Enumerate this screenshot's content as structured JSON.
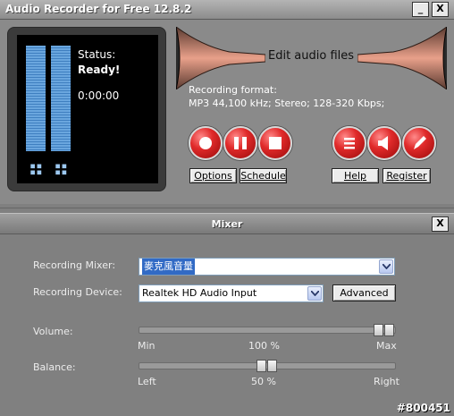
{
  "app": {
    "title": "Audio Recorder for Free 12.8.2",
    "minimize": "_",
    "close": "X"
  },
  "display": {
    "status_label": "Status:",
    "status_value": "Ready!",
    "time": "0:00:00"
  },
  "editor": {
    "label": "Edit audio files"
  },
  "format": {
    "label": "Recording format:",
    "value": "MP3 44,100 kHz; Stereo;  128-320 Kbps;"
  },
  "transport": {
    "buttons": [
      "record",
      "pause",
      "stop"
    ],
    "options": "Options",
    "schedule": "Schedule"
  },
  "extras": {
    "buttons": [
      "menu",
      "volume",
      "edit"
    ],
    "help": "Help",
    "register": "Register"
  },
  "mixer": {
    "title": "Mixer",
    "close": "X",
    "recording_mixer_label": "Recording Mixer:",
    "recording_mixer_value": "麥克風音量",
    "recording_device_label": "Recording Device:",
    "recording_device_value": "Realtek HD Audio Input",
    "advanced": "Advanced",
    "volume": {
      "label": "Volume:",
      "level_percent": 100,
      "min": "Min",
      "mid": "100 %",
      "max": "Max"
    },
    "balance": {
      "label": "Balance:",
      "level_percent": 50,
      "left": "Left",
      "mid": "50 %",
      "right": "Right"
    }
  },
  "watermark": "#800451",
  "colors": {
    "accent_red": "#d02020",
    "meter_blue": "#4f8fd0",
    "selection_blue": "#316ac5"
  }
}
